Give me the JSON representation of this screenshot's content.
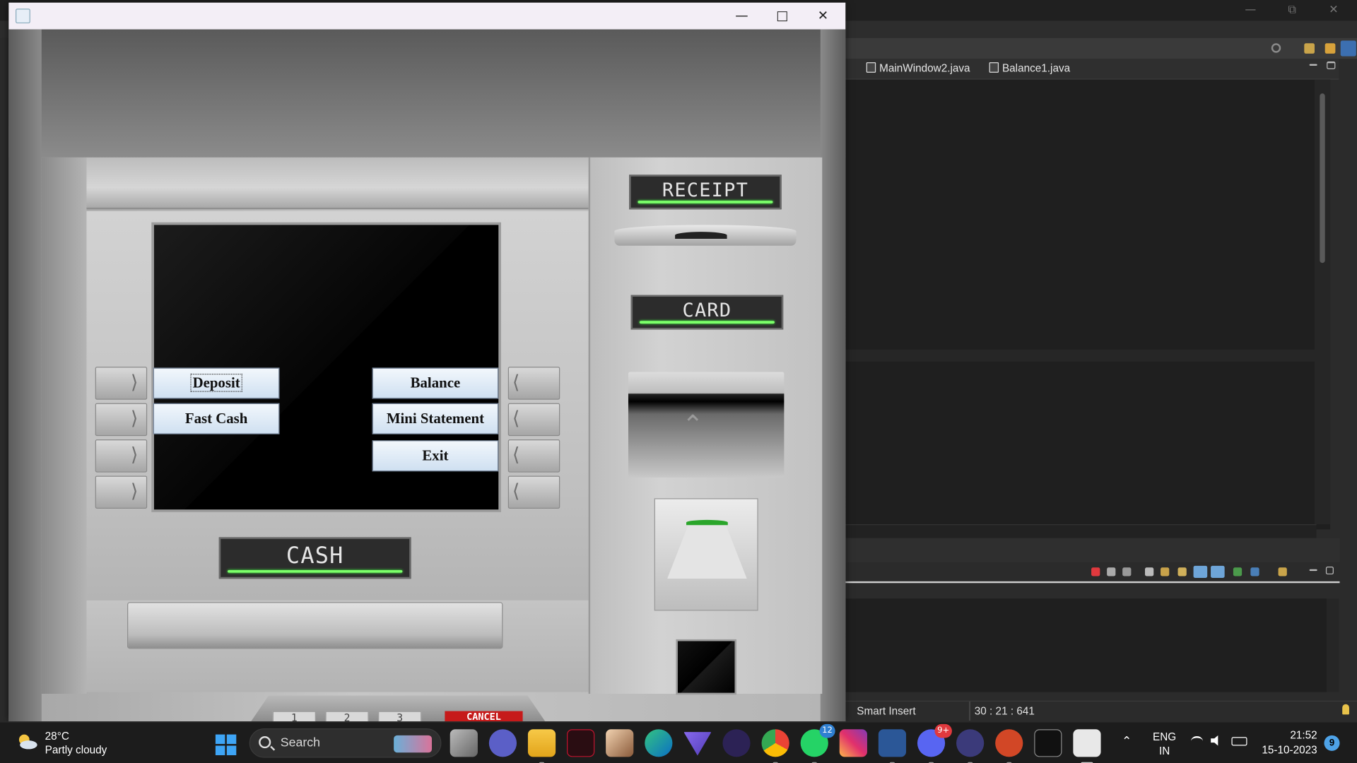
{
  "ide": {
    "tabs": [
      {
        "label": "MainWindow2.java"
      },
      {
        "label": "Balance1.java"
      }
    ],
    "status": {
      "insert_mode": "Smart Insert",
      "cursor_position": "30 : 21 : 641"
    }
  },
  "atm_window": {
    "title_icon": "java-cup-icon",
    "controls": {
      "minimize": "—",
      "maximize": "□",
      "close": "✕"
    },
    "menu": {
      "left": [
        "Deposit",
        "Fast Cash"
      ],
      "right": [
        "Balance",
        "Mini Statement",
        "Exit"
      ]
    },
    "labels": {
      "receipt": "RECEIPT",
      "card": "CARD",
      "cash": "CASH"
    },
    "keypad": {
      "keys": [
        "1",
        "2",
        "3"
      ],
      "cancel": "CANCEL"
    },
    "colors": {
      "led_green": "#7cff6a",
      "cancel_red": "#c61a1a",
      "button_blue": "#cfe0f1"
    }
  },
  "taskbar": {
    "weather": {
      "temp": "28°C",
      "desc": "Partly cloudy"
    },
    "search_placeholder": "Search",
    "apps": [
      {
        "name": "task-view-icon"
      },
      {
        "name": "teams-chat-icon"
      },
      {
        "name": "file-explorer-icon"
      },
      {
        "name": "vectary-icon"
      },
      {
        "name": "photos-icon"
      },
      {
        "name": "edge-icon"
      },
      {
        "name": "proton-vpn-icon"
      },
      {
        "name": "eclipse-icon"
      },
      {
        "name": "chrome-icon"
      },
      {
        "name": "whatsapp-icon",
        "badge": "12"
      },
      {
        "name": "instagram-icon"
      },
      {
        "name": "word-icon"
      },
      {
        "name": "discord-icon",
        "badge": "9+"
      },
      {
        "name": "eclipse-ide-icon"
      },
      {
        "name": "powerpoint-icon"
      },
      {
        "name": "terminal-icon"
      },
      {
        "name": "java-icon"
      }
    ],
    "tray": {
      "lang_top": "ENG",
      "lang_bottom": "IN",
      "time": "21:52",
      "date": "15-10-2023",
      "notifications": "9"
    }
  }
}
